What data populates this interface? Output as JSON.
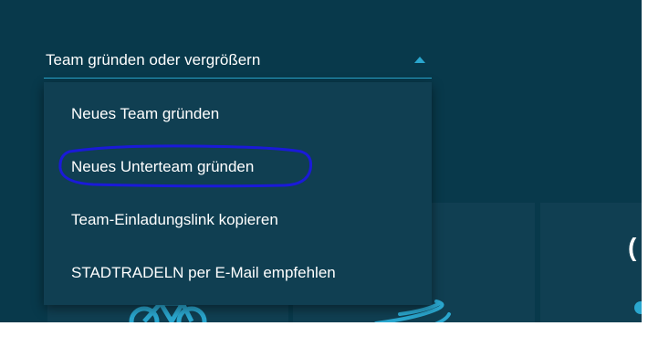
{
  "dropdown": {
    "selected_label": "Team gründen oder vergrößern",
    "options": [
      {
        "label": "Neues Team gründen"
      },
      {
        "label": "Neues Unterteam gründen"
      },
      {
        "label": "Team-Einladungslink kopieren"
      },
      {
        "label": "STADTRADELN per E-Mail empfehlen"
      }
    ]
  },
  "colors": {
    "background": "#08394b",
    "menu": "#103f52",
    "accent": "#2aa7cf",
    "highlight_annotation": "#1a1ad8"
  },
  "icons": [
    "caret-up-icon",
    "bicycle-icon",
    "swoosh-icon"
  ]
}
